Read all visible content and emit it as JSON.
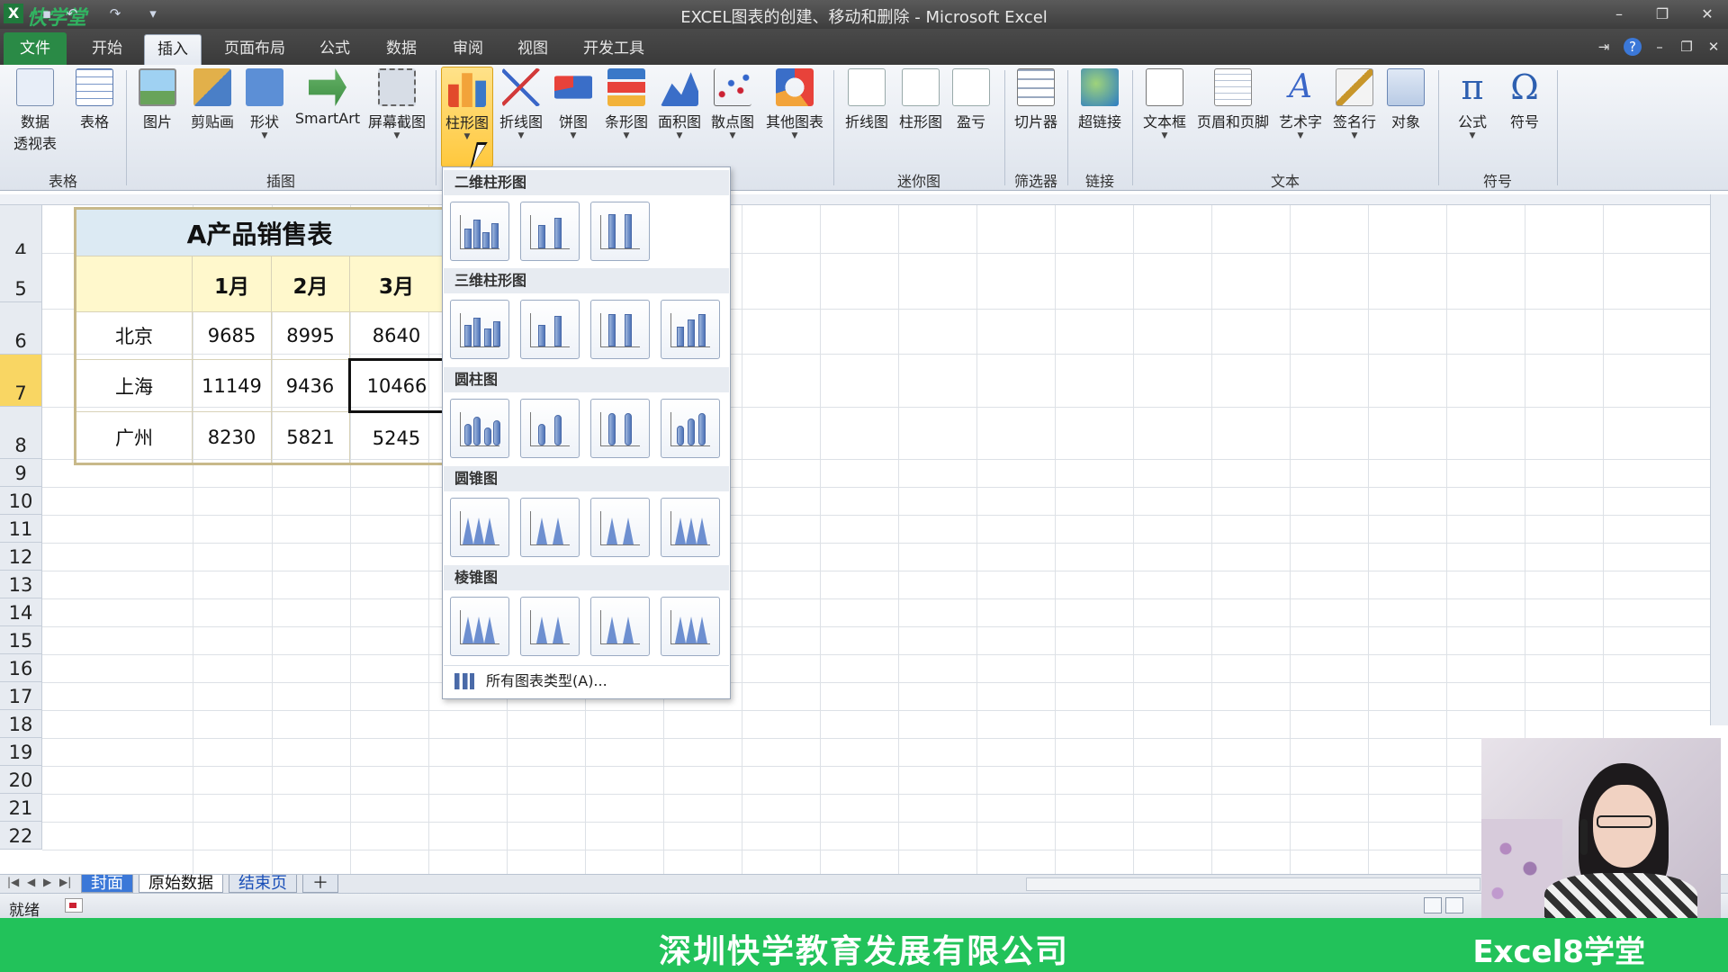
{
  "window": {
    "title": "EXCEL图表的创建、移动和删除 - Microsoft Excel",
    "watermark": "快学堂"
  },
  "tabs": [
    {
      "label": "文件",
      "kind": "file"
    },
    {
      "label": "开始"
    },
    {
      "label": "插入",
      "active": true
    },
    {
      "label": "页面布局"
    },
    {
      "label": "公式"
    },
    {
      "label": "数据"
    },
    {
      "label": "审阅"
    },
    {
      "label": "视图"
    },
    {
      "label": "开发工具"
    }
  ],
  "ribbon": {
    "buttons": {
      "pivot": {
        "line1": "数据",
        "line2": "透视表",
        "icon": "pivot-table-icon"
      },
      "table": {
        "label": "表格",
        "icon": "table-icon"
      },
      "picture": {
        "label": "图片",
        "icon": "picture-icon"
      },
      "clipart": {
        "label": "剪贴画",
        "icon": "clipart-icon"
      },
      "shapes": {
        "label": "形状",
        "icon": "shapes-icon"
      },
      "smartart": {
        "label": "SmartArt",
        "icon": "smartart-icon"
      },
      "screenshot": {
        "label": "屏幕截图",
        "icon": "screenshot-icon"
      },
      "column": {
        "label": "柱形图",
        "icon": "column-chart-icon"
      },
      "line": {
        "label": "折线图",
        "icon": "line-chart-icon"
      },
      "pie": {
        "label": "饼图",
        "icon": "pie-chart-icon"
      },
      "bar": {
        "label": "条形图",
        "icon": "bar-chart-icon"
      },
      "area": {
        "label": "面积图",
        "icon": "area-chart-icon"
      },
      "scatter": {
        "label": "散点图",
        "icon": "scatter-chart-icon"
      },
      "other": {
        "label": "其他图表",
        "icon": "other-charts-icon"
      },
      "spark_line": {
        "label": "折线图",
        "icon": "sparkline-line-icon"
      },
      "spark_column": {
        "label": "柱形图",
        "icon": "sparkline-column-icon"
      },
      "spark_winloss": {
        "label": "盈亏",
        "icon": "sparkline-winloss-icon"
      },
      "slicer": {
        "label": "切片器",
        "icon": "slicer-icon"
      },
      "hyperlink": {
        "label": "超链接",
        "icon": "hyperlink-icon"
      },
      "textbox": {
        "label": "文本框",
        "icon": "textbox-icon"
      },
      "header_footer": {
        "label": "页眉和页脚",
        "icon": "header-footer-icon"
      },
      "wordart": {
        "label": "艺术字",
        "icon": "wordart-icon"
      },
      "signature": {
        "label": "签名行",
        "icon": "signature-icon"
      },
      "object": {
        "label": "对象",
        "icon": "object-icon"
      },
      "equation": {
        "label": "公式",
        "icon": "pi-icon"
      },
      "symbol": {
        "label": "符号",
        "icon": "omega-icon"
      }
    },
    "groups": {
      "tables": "表格",
      "illustrations": "插图",
      "sparklines": "迷你图",
      "filter": "筛选器",
      "links": "链接",
      "text": "文本",
      "symbols": "符号"
    }
  },
  "gallery": {
    "sections": [
      {
        "title": "二维柱形图",
        "count": 3
      },
      {
        "title": "三维柱形图",
        "count": 4
      },
      {
        "title": "圆柱图",
        "count": 4
      },
      {
        "title": "圆锥图",
        "count": 4
      },
      {
        "title": "棱锥图",
        "count": 4
      }
    ],
    "footer": "所有图表类型(A)..."
  },
  "sheet": {
    "row_numbers": [
      "4",
      "5",
      "6",
      "7",
      "8",
      "9",
      "10",
      "11",
      "12",
      "13",
      "14",
      "15",
      "16",
      "17",
      "18",
      "19",
      "20",
      "21",
      "22"
    ],
    "selected_row": "7",
    "table": {
      "title": "A产品销售表",
      "headers": [
        "",
        "1月",
        "2月",
        "3月"
      ],
      "rows": [
        [
          "北京",
          "9685",
          "8995",
          "8640"
        ],
        [
          "上海",
          "11149",
          "9436",
          "10466"
        ],
        [
          "广州",
          "8230",
          "5821",
          "5245"
        ]
      ]
    }
  },
  "sheet_tabs": [
    "封面",
    "原始数据",
    "结束页"
  ],
  "status": {
    "ready": "就绪"
  },
  "banner": {
    "company": "深圳快学教育发展有限公司",
    "brand": "Excel8学堂"
  }
}
